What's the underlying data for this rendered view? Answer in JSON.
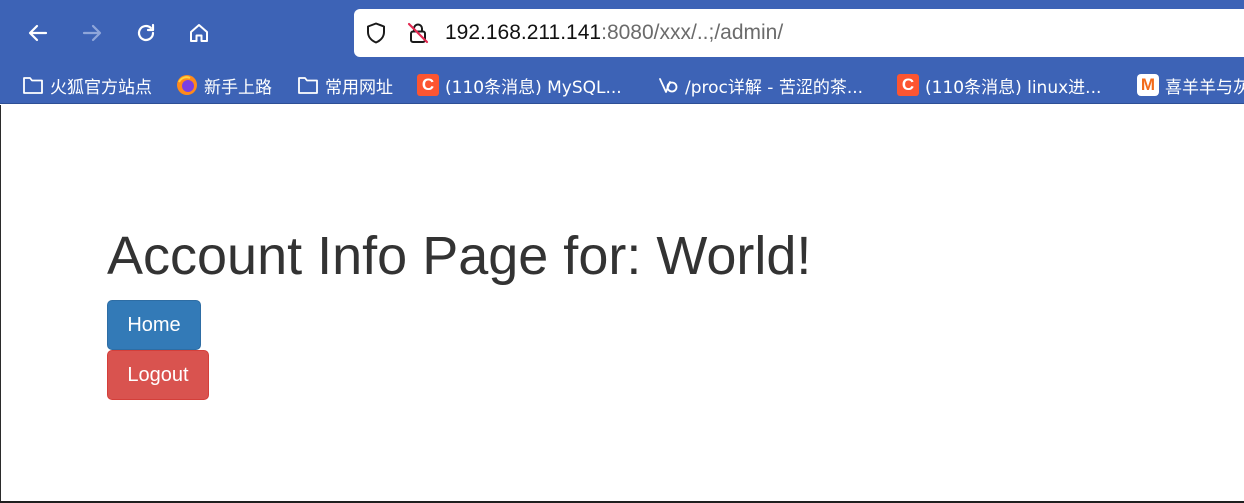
{
  "browser": {
    "url": {
      "host": "192.168.211.141",
      "rest": ":8080/xxx/..;/admin/"
    },
    "bookmarks": [
      {
        "label": "火狐官方站点",
        "icon": "folder-icon"
      },
      {
        "label": "新手上路",
        "icon": "firefox-icon"
      },
      {
        "label": "常用网址",
        "icon": "folder-icon"
      },
      {
        "label": "(110条消息) MySQL...",
        "icon": "csdn-icon",
        "icon_text": "C"
      },
      {
        "label": "/proc详解 - 苦涩的茶...",
        "icon": "site-icon"
      },
      {
        "label": "(110条消息) linux进...",
        "icon": "csdn-icon",
        "icon_text": "C"
      },
      {
        "label": "喜羊羊与灰",
        "icon": "m-icon",
        "icon_text": "M"
      }
    ]
  },
  "page": {
    "title": "Account Info Page for: World!",
    "buttons": {
      "home": "Home",
      "logout": "Logout"
    }
  },
  "colors": {
    "toolbar": "#3d63b6",
    "home_button": "#337ab7",
    "logout_button": "#d9534f",
    "csdn_icon": "#fc5531"
  }
}
